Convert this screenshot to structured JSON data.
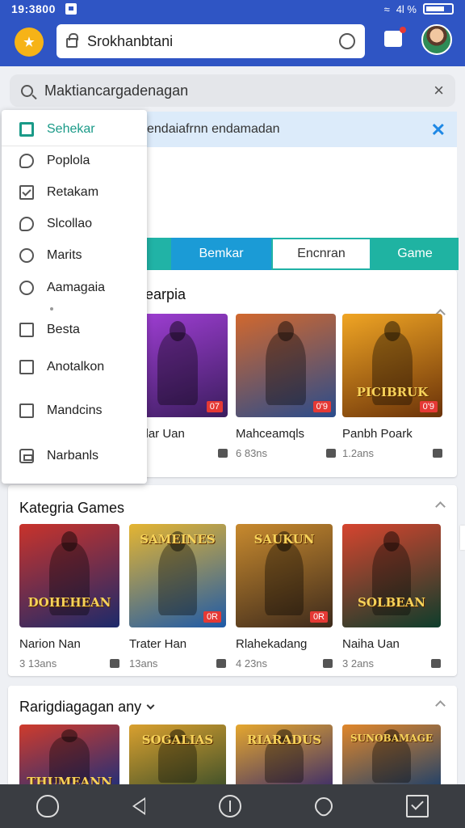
{
  "status": {
    "time": "19:3800",
    "signal_text": "4l %"
  },
  "header": {
    "url": "Srokhanbtani"
  },
  "search": {
    "text": "Maktiancargadenagan"
  },
  "banner": {
    "text": "endaiafrnn endamadan"
  },
  "dropdown": {
    "items": [
      {
        "label": "Sehekar",
        "icon": "square",
        "active": true
      },
      {
        "label": "Poplola",
        "icon": "bubble"
      },
      {
        "label": "Retakam",
        "icon": "check"
      },
      {
        "label": "Slcollao",
        "icon": "bubble"
      },
      {
        "label": "Marits",
        "icon": "circle"
      },
      {
        "label": "Aamagaia",
        "icon": "circle"
      },
      {
        "label": "Besta",
        "icon": "square"
      },
      {
        "label": "Anotalkon",
        "icon": "square"
      },
      {
        "label": "Mandcins",
        "icon": "square"
      },
      {
        "label": "Narbanls",
        "icon": "box"
      }
    ]
  },
  "tabs": [
    "Bemkar",
    "Encnran",
    "Game"
  ],
  "sections": [
    {
      "title": "earpia",
      "games": [
        {
          "name": "rtarlar Uan",
          "meta": "ns",
          "badge": "07",
          "logo": "",
          "colors": [
            "#3b1d5e",
            "#a13fd6"
          ]
        },
        {
          "name": "Mahceamqls",
          "meta": "6 83ns",
          "badge": "0'9",
          "logo": "",
          "colors": [
            "#2a4c8c",
            "#d1682e"
          ]
        },
        {
          "name": "Panbh Poark",
          "meta": "1.2ans",
          "badge": "0'9",
          "logo": "PICIBRUK",
          "colors": [
            "#6a3209",
            "#f0a524"
          ]
        }
      ]
    },
    {
      "title": "Kategria Games",
      "games": [
        {
          "name": "Narion Nan",
          "meta": "3 13ans",
          "badge": "",
          "logo": "DOHEHEAN",
          "colors": [
            "#1c2a6b",
            "#c9332b"
          ]
        },
        {
          "name": "Trater Han",
          "meta": "13ans",
          "badge": "0R",
          "logo": "SAMEINES",
          "colors": [
            "#1e5aa8",
            "#e5b531"
          ]
        },
        {
          "name": "Rlahekadang",
          "meta": "4 23ns",
          "badge": "0R",
          "logo": "SAUKUN",
          "colors": [
            "#3d2a1c",
            "#c88a2e"
          ]
        },
        {
          "name": "Naiha Uan",
          "meta": "3 2ans",
          "badge": "",
          "logo": "SOLBEAN",
          "colors": [
            "#0e3d2c",
            "#d6452f"
          ]
        }
      ]
    },
    {
      "title": "Rarigdiagagan any",
      "games": [
        {
          "name": "",
          "meta": "",
          "badge": "",
          "logo": "THUMEANN",
          "colors": [
            "#1d2f7a",
            "#cf3b2c"
          ]
        },
        {
          "name": "",
          "meta": "",
          "badge": "",
          "logo": "SOGALIAS",
          "colors": [
            "#3c4f2a",
            "#d9a02e"
          ]
        },
        {
          "name": "",
          "meta": "",
          "badge": "",
          "logo": "RIARADUS",
          "colors": [
            "#3a2b6a",
            "#e5a72e"
          ]
        },
        {
          "name": "",
          "meta": "",
          "badge": "",
          "logo": "SUNOBAMAGE",
          "colors": [
            "#1b3f6b",
            "#e0872b"
          ]
        }
      ]
    }
  ],
  "colors": {
    "header": "#2f55c4",
    "accent": "#1a9a88",
    "nav": "#3a3d42"
  }
}
